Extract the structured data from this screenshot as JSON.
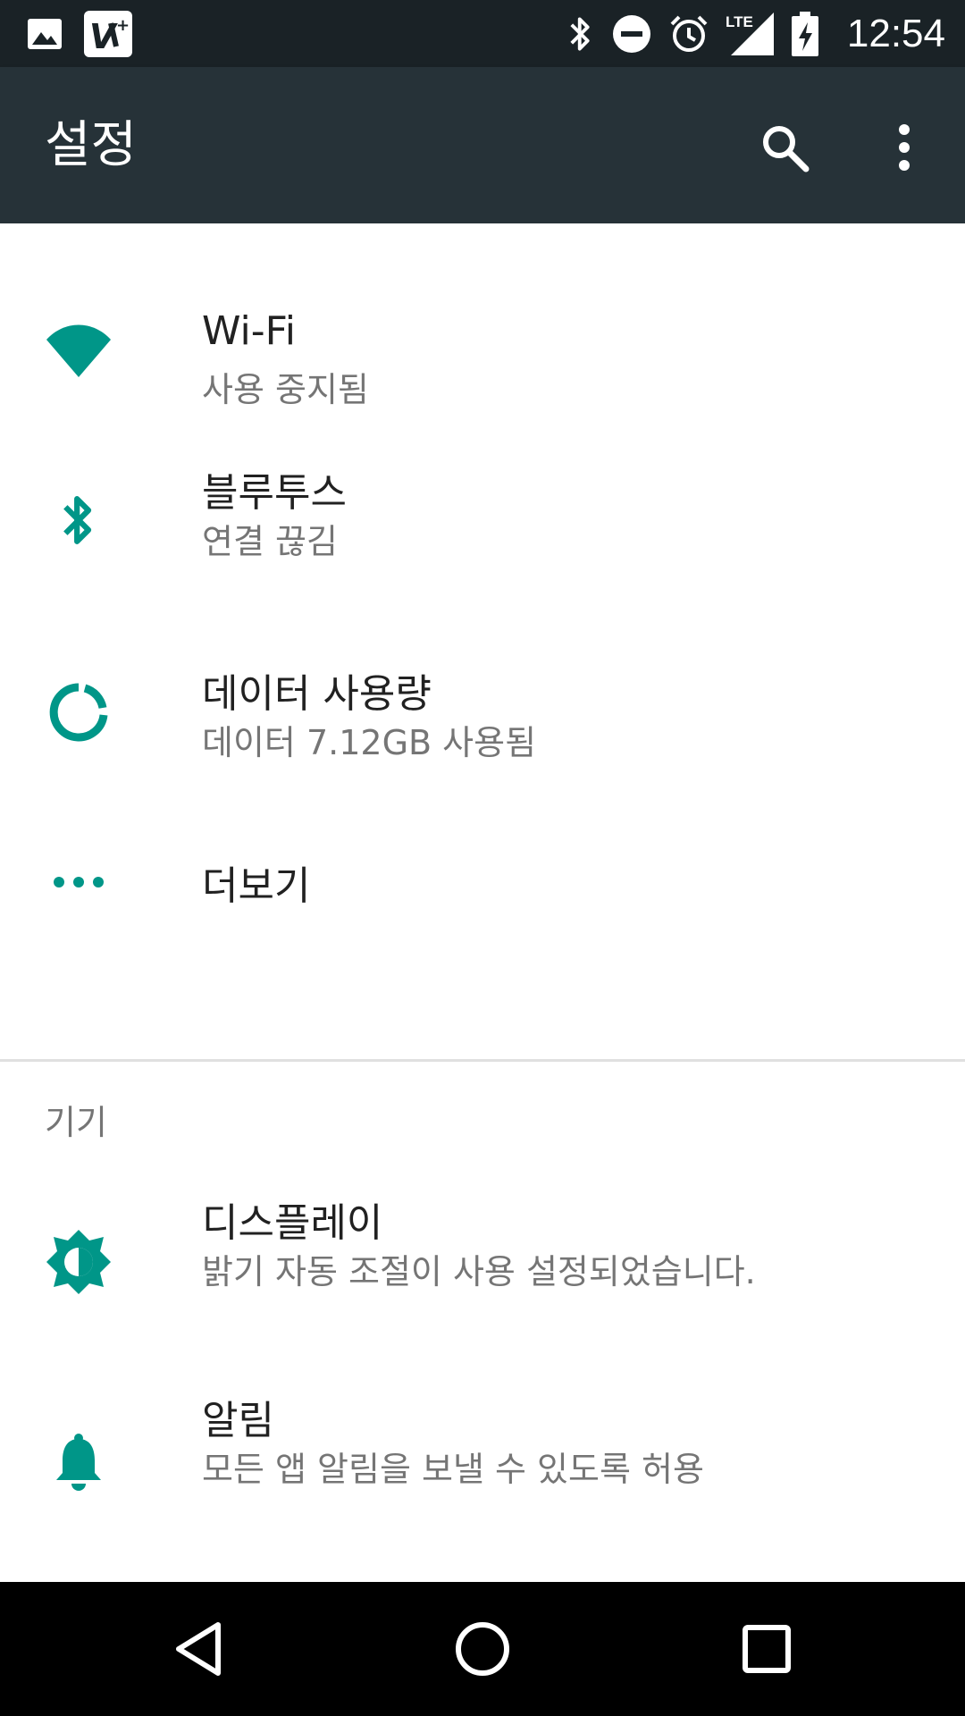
{
  "status_bar": {
    "time": "12:54",
    "network": "LTE",
    "icons": [
      "image-icon",
      "app-notification-icon",
      "bluetooth-icon",
      "do-not-disturb-icon",
      "alarm-icon",
      "lte-signal-icon",
      "battery-charging-icon"
    ]
  },
  "app_bar": {
    "title": "설정",
    "actions": [
      "search-icon",
      "more-vert-icon"
    ]
  },
  "settings": {
    "wifi": {
      "title": "Wi-Fi",
      "subtitle": "사용 중지됨",
      "icon": "wifi-icon"
    },
    "bluetooth": {
      "title": "블루투스",
      "subtitle": "연결 끊김",
      "icon": "bluetooth-icon"
    },
    "data_usage": {
      "title": "데이터 사용량",
      "subtitle": "데이터 7.12GB 사용됨",
      "icon": "data-usage-icon"
    },
    "more": {
      "title": "더보기",
      "icon": "more-horiz-icon"
    },
    "device_section": {
      "header": "기기"
    },
    "display": {
      "title": "디스플레이",
      "subtitle": "밝기 자동 조절이 사용 설정되었습니다.",
      "icon": "brightness-icon"
    },
    "notifications": {
      "title": "알림",
      "subtitle": "모든 앱 알림을 보낼 수 있도록 허용",
      "icon": "bell-icon"
    }
  },
  "nav_bar": {
    "buttons": [
      "back-icon",
      "home-icon",
      "recents-icon"
    ]
  },
  "colors": {
    "accent": "#009688",
    "app_bar": "#263238",
    "status_bar": "#1a2226"
  }
}
